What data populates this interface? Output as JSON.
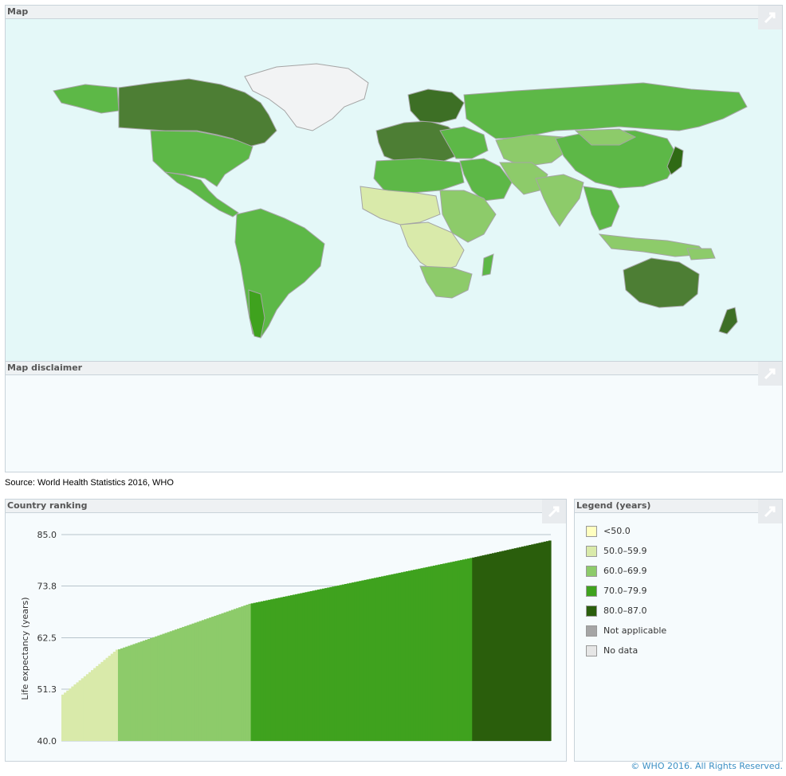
{
  "panels": {
    "map_title": "Map",
    "disclaimer_title": "Map disclaimer",
    "ranking_title": "Country ranking",
    "legend_title": "Legend (years)"
  },
  "source": "Source: World Health Statistics 2016, WHO",
  "footer": "© WHO 2016. All Rights Reserved.",
  "icons": {
    "expand": "expand-icon"
  },
  "legend": [
    {
      "label": "<50.0",
      "color": "#ffffc0"
    },
    {
      "label": "50.0–59.9",
      "color": "#d9eaaa"
    },
    {
      "label": "60.0–69.9",
      "color": "#8dcb6a"
    },
    {
      "label": "70.0–79.9",
      "color": "#3fa21e"
    },
    {
      "label": "80.0–87.0",
      "color": "#2a5e0c"
    },
    {
      "label": "Not applicable",
      "color": "#a5a5a5"
    },
    {
      "label": "No data",
      "color": "#e6e6e6"
    }
  ],
  "chart_data": {
    "type": "bar",
    "ylabel": "Life expectancy (years)",
    "yticks": [
      40.0,
      51.3,
      62.5,
      73.8,
      85.0
    ],
    "ytick_labels": [
      "40.0",
      "51.3",
      "62.5",
      "73.8",
      "85.0"
    ],
    "ylim": [
      40.0,
      85.0
    ],
    "grid": true,
    "bands": [
      {
        "range": "50.0–59.9",
        "color": "#d9eaaa",
        "from": 50.1,
        "to": 59.9,
        "count": 23
      },
      {
        "range": "60.0–69.9",
        "color": "#8dcb6a",
        "from": 60.0,
        "to": 69.9,
        "count": 54
      },
      {
        "range": "70.0–79.9",
        "color": "#3fa21e",
        "from": 70.0,
        "to": 79.9,
        "count": 90
      },
      {
        "range": "80.0–87.0",
        "color": "#2a5e0c",
        "from": 80.0,
        "to": 83.7,
        "count": 32
      }
    ]
  }
}
